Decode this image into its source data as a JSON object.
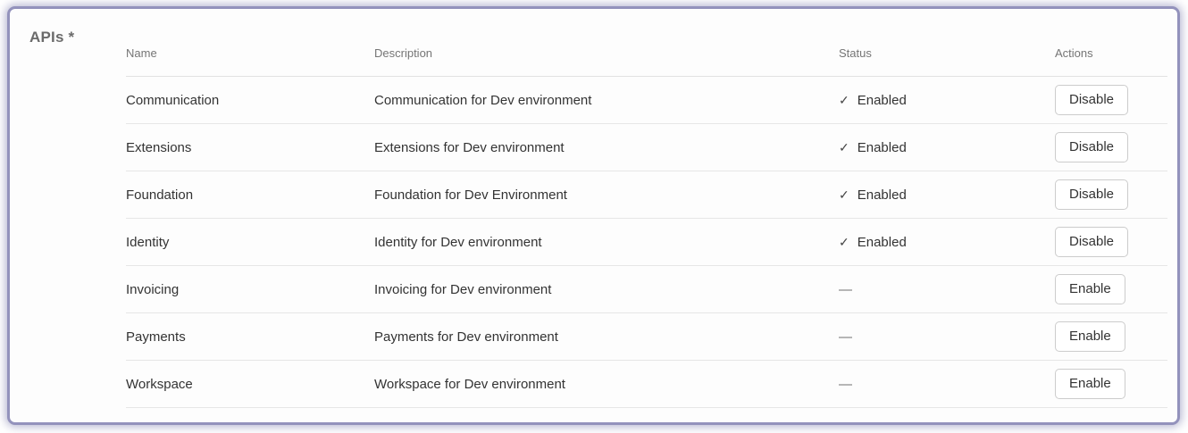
{
  "colors": {
    "frame_border": "#9392bc",
    "divider": "#e6e6e6",
    "header_text": "#757575",
    "body_text": "#333333",
    "background": "#fdfdfd"
  },
  "panel": {
    "label": "APIs *"
  },
  "icons": {
    "check": "✓"
  },
  "table": {
    "columns": [
      {
        "label": "Name"
      },
      {
        "label": "Description"
      },
      {
        "label": "Status"
      },
      {
        "label": "Actions"
      }
    ],
    "rows": [
      {
        "name": "Communication",
        "description": "Communication for Dev environment",
        "status": "Enabled",
        "enabled": true,
        "action": "Disable"
      },
      {
        "name": "Extensions",
        "description": "Extensions for Dev environment",
        "status": "Enabled",
        "enabled": true,
        "action": "Disable"
      },
      {
        "name": "Foundation",
        "description": "Foundation for Dev Environment",
        "status": "Enabled",
        "enabled": true,
        "action": "Disable"
      },
      {
        "name": "Identity",
        "description": "Identity for Dev environment",
        "status": "Enabled",
        "enabled": true,
        "action": "Disable"
      },
      {
        "name": "Invoicing",
        "description": "Invoicing for Dev environment",
        "status": "—",
        "enabled": false,
        "action": "Enable"
      },
      {
        "name": "Payments",
        "description": "Payments for Dev environment",
        "status": "—",
        "enabled": false,
        "action": "Enable"
      },
      {
        "name": "Workspace",
        "description": "Workspace for Dev environment",
        "status": "—",
        "enabled": false,
        "action": "Enable"
      }
    ]
  }
}
